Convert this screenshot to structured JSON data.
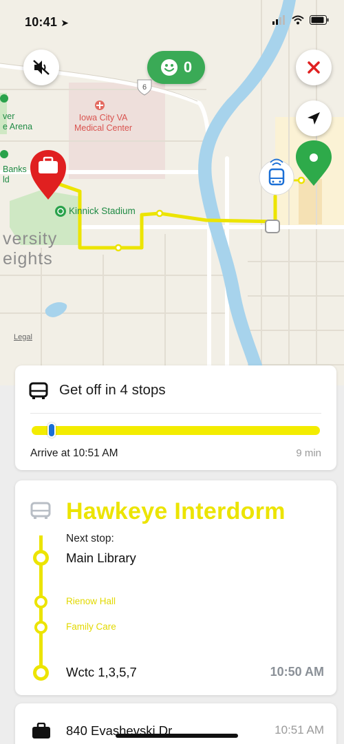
{
  "status_bar": {
    "time": "10:41"
  },
  "map": {
    "happy_count": "0",
    "labels": {
      "va_center": "Iowa City VA\nMedical Center",
      "stadium": "Kinnick Stadium",
      "arena_partial": "ver\ne Arena",
      "banks_partial": "Banks\nld",
      "university_partial": "versity\neights",
      "legal": "Legal",
      "highway": "6"
    },
    "icons": {
      "mute": "mute-speaker-icon",
      "happy": "smiley-face-icon",
      "close": "close-x-icon",
      "locate": "location-arrow-icon",
      "origin_pin": "briefcase-pin-icon",
      "bus_position": "live-bus-icon",
      "destination_pin": "destination-pin-icon"
    },
    "colors": {
      "route": "#ece400",
      "river": "#a7d3ec",
      "park": "#cfe8c4",
      "close": "#e02020",
      "happy": "#3aaa56",
      "origin_pin": "#e02020",
      "dest_pin": "#2eaa4a"
    }
  },
  "progress_card": {
    "title": "Get off in 4 stops",
    "arrive_text": "Arrive at 10:51 AM",
    "duration": "9 min",
    "progress": 0.07
  },
  "route_card": {
    "route_name": "Hawkeye Interdorm",
    "next_stop_label": "Next stop:",
    "next_stop": "Main Library",
    "intermediate_stops": [
      "Rienow Hall",
      "Family Care"
    ],
    "final_stop": "Wctc 1,3,5,7",
    "final_time": "10:50 AM"
  },
  "destination_card": {
    "address": "840 Evashevski Dr",
    "time": "10:51 AM"
  }
}
